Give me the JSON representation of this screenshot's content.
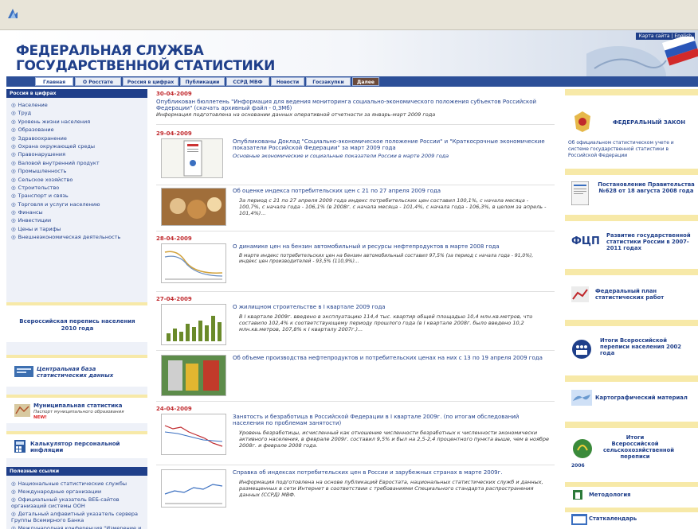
{
  "header": {
    "title_line1": "ФЕДЕРАЛЬНАЯ СЛУЖБА",
    "title_line2": "ГОСУДАРСТВЕННОЙ СТАТИСТИКИ",
    "toplinks": "Карта сайта | English"
  },
  "nav": {
    "tabs": [
      "Главная",
      "О Росстате",
      "Россия в цифрах",
      "Публикации",
      "ССРД МВФ",
      "Новости",
      "Госзакупки",
      "Далее"
    ]
  },
  "left": {
    "menu_title": "Россия в цифрах",
    "menu": [
      "Население",
      "Труд",
      "Уровень жизни населения",
      "Образование",
      "Здравоохранение",
      "Охрана окружающей среды",
      "Правонарушения",
      "Валовой внутренний продукт",
      "Промышленность",
      "Сельское хозяйство",
      "Строительство",
      "Транспорт и связь",
      "Торговля и услуги населению",
      "Финансы",
      "Инвестиции",
      "Цены и тарифы",
      "Внешнеэкономическая деятельность"
    ],
    "census_box": "Всероссийская перепись населения 2010 года",
    "central_db": "Центральная база статистических данных",
    "municipal": "Муниципальная статистика",
    "municipal_sub": "Паспорт муниципального образования",
    "municipal_new": "NEW!",
    "calculator": "Калькулятор персональной инфляции",
    "links_title": "Полезные ссылки",
    "links": [
      "Национальные статистические службы",
      "Международные организации",
      "Официальный указатель ВЕБ-сайтов организаций системы ООН",
      "Детальный алфавитный указатель сервера Группы Всемирного Банка",
      "Международная конференция \"Измерение и содействие прогрессу: новый подход для стран СНГ и"
    ]
  },
  "news": [
    {
      "date": "30-04-2009",
      "title": "Опубликован бюллетень \"Информация для ведения мониторинга социально-экономического положения субъектов Российской Федерации\" (скачать архивный файл - 0,3Мб)",
      "text": "Информация подготовлена на основании данных оперативной отчетности за январь-март 2009 года"
    },
    {
      "date": "29-04-2009",
      "title": "Опубликованы Доклад \"Социально-экономическое положение России\" и \"Краткосрочные экономические показатели Российской Федерации\" за март 2009 года",
      "text": "Основные экономические и социальные показатели России в марте 2009 года"
    },
    {
      "date": "",
      "title": "Об оценке индекса потребительских цен с 21 по 27 апреля 2009 года",
      "text": "За период с 21 по 27 апреля 2009 года индекс потребительских цен составил 100,1%, с начала месяца - 100,7%, с начала года - 106,1% (в 2008г. с начала месяца - 101,4%, с начала года - 106,3%, в целом за апрель - 101,4%)..."
    },
    {
      "date": "28-04-2009",
      "title": "О динамике цен на бензин автомобильный и ресурсы нефтепродуктов в марте 2008 года",
      "text": "В марте индекс потребительских цен на бензин автомобильный составил 97,5% (за период с начала года - 91,0%), индекс цен производителей - 93,5% (110,9%)..."
    },
    {
      "date": "27-04-2009",
      "title": "О жилищном строительстве в I квартале 2009 года",
      "text": "В I квартале 2009г. введено в эксплуатацию 114,4 тыс. квартир общей площадью 10,4 млн.кв.метров, что составило 102,4% к соответствующему периоду прошлого года (в I квартале 2008г. было введено 10,2 млн.кв.метров, 107,8% к I кварталу 2007г.)..."
    },
    {
      "date": "",
      "title": "Об объеме производства нефтепродуктов и потребительских ценах на них с 13 по 19 апреля 2009 года",
      "text": ""
    },
    {
      "date": "24-04-2009",
      "title": "Занятость и безработица в Российской Федерации в I квартале 2009г. (по итогам обследований населения по проблемам занятости)",
      "text": "Уровень безработицы, исчисленный как отношение численности безработных к численности экономически активного населения, в феврале 2009г. составил 9,5% и был на 2,5-2,4 процентного пункта выше, чем в ноябре 2008г. и феврале 2008 года."
    },
    {
      "date": "",
      "title": "Справка об индексах потребительских цен в России и зарубежных странах в марте 2009г.",
      "text": "Информация подготовлена на основе публикаций Евростата, национальных статистических служб и данных, размещенных в сети Интернет в соответствии с требованиями Специального стандарта распространения данных (ССРД) МВФ."
    }
  ],
  "right": {
    "law_title": "ФЕДЕРАЛЬНЫЙ ЗАКОН",
    "law_text": "Об официальном статистическом учете и системе государственной статистики в Российской Федерации",
    "decree": "Постановление Правительства №628 от 18 августа 2008 года",
    "fcp": "Развитие государственной статистики России в 2007-2011 годах",
    "fcp_logo": "ФЦП",
    "plan": "Федеральный план статистических работ",
    "census2002": "Итоги Всероссийской переписи населения 2002 года",
    "carto": "Картографический материал",
    "agro": "Итоги Всероссийской сельскохозяйственной переписи",
    "agro_year": "2006",
    "method": "Методология",
    "calendar": "Статкалендарь"
  }
}
